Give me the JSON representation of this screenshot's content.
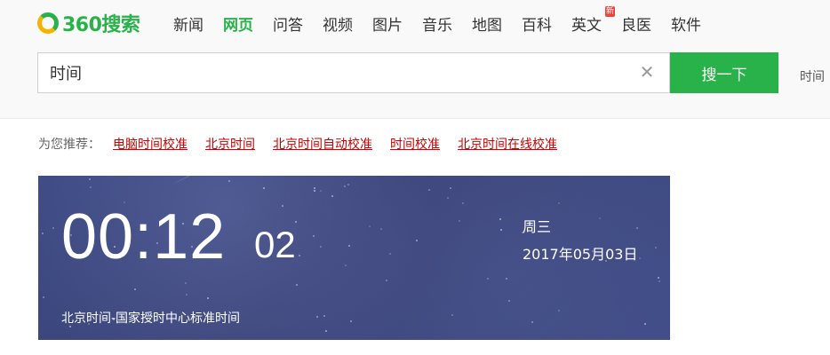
{
  "logo": {
    "text": "360搜索"
  },
  "nav": {
    "items": [
      {
        "label": "新闻"
      },
      {
        "label": "网页",
        "active": true
      },
      {
        "label": "问答"
      },
      {
        "label": "视频"
      },
      {
        "label": "图片"
      },
      {
        "label": "音乐"
      },
      {
        "label": "地图"
      },
      {
        "label": "百科"
      },
      {
        "label": "英文",
        "badge": "新"
      },
      {
        "label": "良医"
      },
      {
        "label": "软件"
      }
    ]
  },
  "search": {
    "value": "时间",
    "button_label": "搜一下",
    "side_text": "时间"
  },
  "recommend": {
    "label": "为您推荐：",
    "links": [
      "电脑时间校准",
      "北京时间",
      "北京时间自动校准",
      "时间校准",
      "北京时间在线校准"
    ]
  },
  "clock": {
    "hours_minutes": "00:12",
    "seconds": "02",
    "weekday": "周三",
    "date": "2017年05月03日",
    "source": "北京时间-国家授时中心标准时间"
  },
  "colors": {
    "brand_green": "#2ab24a",
    "link_red": "#cc0000",
    "card_bg": "#3e4a84"
  }
}
